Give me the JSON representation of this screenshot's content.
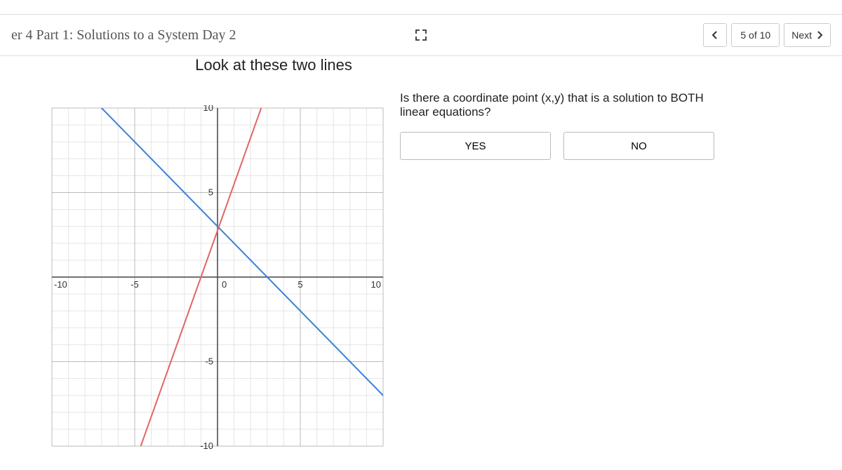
{
  "header": {
    "title": "er 4 Part 1: Solutions to a System Day 2",
    "page_indicator": "5 of 10",
    "next_label": "Next"
  },
  "main": {
    "title": "Look at these two lines",
    "question": "Is there a coordinate point (x,y) that is a solution to BOTH linear equations?",
    "answers": {
      "yes": "YES",
      "no": "NO"
    }
  },
  "chart_data": {
    "type": "line",
    "xlabel": "",
    "ylabel": "",
    "xlim": [
      -10,
      10
    ],
    "ylim": [
      -10,
      10
    ],
    "x_ticks": [
      -10,
      -5,
      0,
      5,
      10
    ],
    "y_ticks": [
      -10,
      -5,
      0,
      5,
      10
    ],
    "series": [
      {
        "name": "blue",
        "color": "#3b82d6",
        "points": [
          [
            -8,
            11
          ],
          [
            10.5,
            -7.5
          ]
        ]
      },
      {
        "name": "red",
        "color": "#e06666",
        "points": [
          [
            -5,
            -11
          ],
          [
            3,
            11
          ]
        ]
      }
    ]
  }
}
